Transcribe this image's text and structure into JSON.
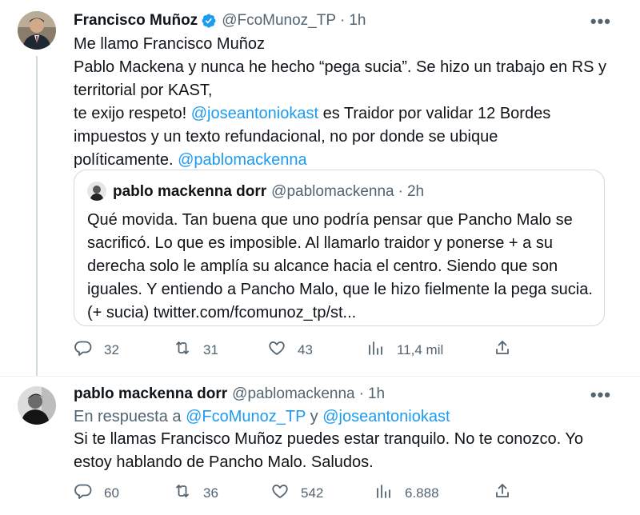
{
  "tweet1": {
    "name": "Francisco Muñoz",
    "handle": "@FcoMunoz_TP",
    "dot": "·",
    "time": "1h",
    "more": "•••",
    "lines": [
      [
        {
          "t": "Me llamo Francisco Muñoz"
        }
      ],
      [
        {
          "t": "Pablo Mackena y nunca he hecho “pega sucia”. Se hizo un trabajo en RS y"
        }
      ],
      [
        {
          "t": "territorial por KAST,"
        }
      ],
      [
        {
          "t": "te exijo respeto! "
        },
        {
          "t": "@joseantoniokast",
          "m": true
        },
        {
          "t": " es Traidor por validar 12 Bordes"
        }
      ],
      [
        {
          "t": "impuestos y un texto refundacional, no por donde se ubique"
        }
      ],
      [
        {
          "t": "políticamente. "
        },
        {
          "t": "@pablomackenna",
          "m": true
        }
      ]
    ],
    "quote": {
      "name": "pablo mackenna dorr",
      "handle": "@pablomackenna",
      "dot": "·",
      "time": "2h",
      "lines": [
        "Qué movida. Tan buena que uno podría pensar que Pancho Malo se",
        "sacrificó. Lo que es imposible. Al llamarlo traidor y ponerse + a su",
        "derecha solo le amplía su alcance hacia el centro. Siendo que son",
        "iguales. Y entiendo a Pancho Malo, que le hizo fielmente la pega sucia.",
        "(+ sucia) twitter.com/fcomunoz_tp/st..."
      ]
    },
    "stats": {
      "replies": "32",
      "retweets": "31",
      "likes": "43",
      "views": "11,4 mil"
    }
  },
  "tweet2": {
    "name": "pablo mackenna dorr",
    "handle": "@pablomackenna",
    "dot": "·",
    "time": "1h",
    "more": "•••",
    "reply_prefix": "En respuesta a ",
    "reply_user1": "@FcoMunoz_TP",
    "reply_and": " y ",
    "reply_user2": "@joseantoniokast",
    "lines": [
      "Si te llamas Francisco Muñoz puedes estar tranquilo. No te conozco. Yo",
      "estoy hablando de Pancho Malo. Saludos."
    ],
    "stats": {
      "replies": "60",
      "retweets": "36",
      "likes": "542",
      "views": "6.888"
    }
  },
  "colors": {
    "accent": "#1d9bf0",
    "muted": "#536471",
    "border": "#cfd9de"
  },
  "icons": [
    "verified-badge-icon",
    "more-icon",
    "reply-icon",
    "retweet-icon",
    "like-icon",
    "views-icon",
    "share-icon"
  ]
}
